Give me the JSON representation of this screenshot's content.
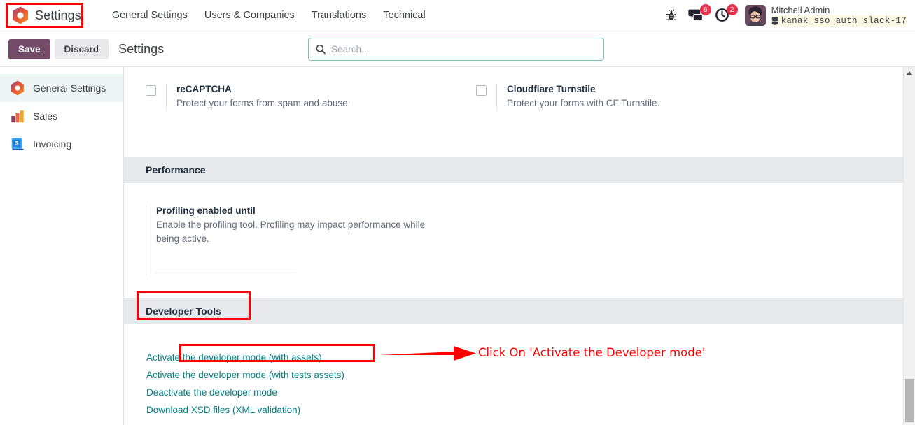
{
  "navbar": {
    "brand": {
      "label": "Settings",
      "icon": "odoo-hexagon-icon"
    },
    "menu_items": [
      {
        "label": "General Settings"
      },
      {
        "label": "Users & Companies"
      },
      {
        "label": "Translations"
      },
      {
        "label": "Technical"
      }
    ],
    "bug_icon": "bug-icon",
    "messages": {
      "icon": "chat-bubble-icon",
      "count": "6"
    },
    "activities": {
      "icon": "clock-icon",
      "count": "2"
    },
    "user": {
      "avatar": "user-avatar",
      "name": "Mitchell Admin",
      "database_icon": "database-icon",
      "database": "kanak_sso_auth_slack-17"
    }
  },
  "control_panel": {
    "save_label": "Save",
    "discard_label": "Discard",
    "title": "Settings",
    "search": {
      "icon": "search-icon",
      "placeholder": "Search...",
      "value": ""
    }
  },
  "sidebar": {
    "items": [
      {
        "label": "General Settings",
        "icon": "settings-gear-icon",
        "active": true
      },
      {
        "label": "Sales",
        "icon": "sales-chart-icon",
        "active": false
      },
      {
        "label": "Invoicing",
        "icon": "invoicing-document-icon",
        "active": false
      }
    ]
  },
  "main": {
    "integrations": {
      "settings": [
        {
          "title": "reCAPTCHA",
          "description": "Protect your forms from spam and abuse.",
          "checked": false
        },
        {
          "title": "Cloudflare Turnstile",
          "description": "Protect your forms with CF Turnstile.",
          "checked": false
        }
      ]
    },
    "performance": {
      "heading": "Performance",
      "profiling": {
        "title": "Profiling enabled until",
        "description": "Enable the profiling tool. Profiling may impact performance while being active.",
        "input_value": ""
      }
    },
    "developer_tools": {
      "heading": "Developer Tools",
      "links": [
        {
          "label": "Activate the developer mode (with assets)"
        },
        {
          "label": "Activate the developer mode (with tests assets)"
        },
        {
          "label": "Deactivate the developer mode"
        },
        {
          "label": "Download XSD files (XML validation)"
        }
      ]
    }
  },
  "annotations": {
    "callout_text": "Click On 'Activate the Developer mode'",
    "highlight_color": "#ff0000"
  },
  "scrollbar": {
    "up_arrow": "scroll-up-arrow-icon"
  }
}
